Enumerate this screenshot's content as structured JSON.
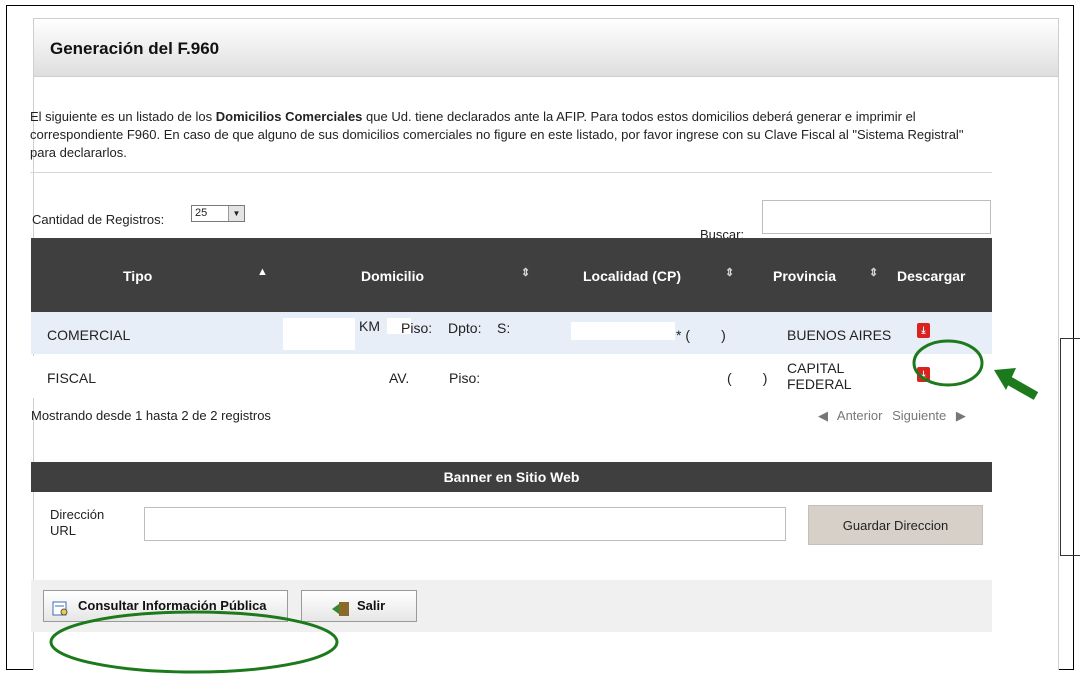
{
  "page": {
    "title": "Generación del F.960",
    "intro_text_1": "El siguiente es un listado de los ",
    "intro_bold": "Domicilios Comerciales",
    "intro_text_2": " que Ud. tiene declarados ante la AFIP. Para todos estos domicilios deberá generar e imprimir el correspondiente F960. En caso de que alguno de sus domicilios comerciales no figure en este listado, por favor ingrese con su Clave Fiscal al \"Sistema Registral\" para declararlos."
  },
  "controls": {
    "cantidad_label": "Cantidad de Registros:",
    "cantidad_value": "25",
    "buscar_label": "Buscar:",
    "buscar_value": ""
  },
  "table": {
    "headers": [
      "Tipo",
      "Domicilio",
      "Localidad (CP)",
      "Provincia",
      "Descargar"
    ],
    "rows": [
      {
        "tipo": "COMERCIAL",
        "dom_a": "KM",
        "dom_b": "Piso:",
        "dom_c": "Dpto:",
        "dom_d": "S:",
        "localidad": "* (        )",
        "provincia": "BUENOS AIRES",
        "descargar_icon": "pdf-icon"
      },
      {
        "tipo": "FISCAL",
        "dom_a": "AV.",
        "dom_b": "Piso:",
        "dom_c": "",
        "dom_d": "",
        "localidad": "(        )",
        "provincia": "CAPITAL FEDERAL",
        "descargar_icon": "pdf-icon"
      }
    ],
    "showing": "Mostrando desde 1 hasta 2 de 2 registros",
    "prev_label": "Anterior",
    "next_label": "Siguiente"
  },
  "banner": {
    "title": "Banner en Sitio Web",
    "dir_label_1": "Dirección",
    "dir_label_2": "URL",
    "url_value": "",
    "save_label": "Guardar Direccion"
  },
  "buttons": {
    "consultar_label": "Consultar Información Pública",
    "salir_label": "Salir"
  },
  "colors": {
    "header_dark": "#3f3f3f",
    "row_highlight": "#e8eef8",
    "annotation_green": "#1c7a1c",
    "pdf_red": "#d9231f"
  }
}
